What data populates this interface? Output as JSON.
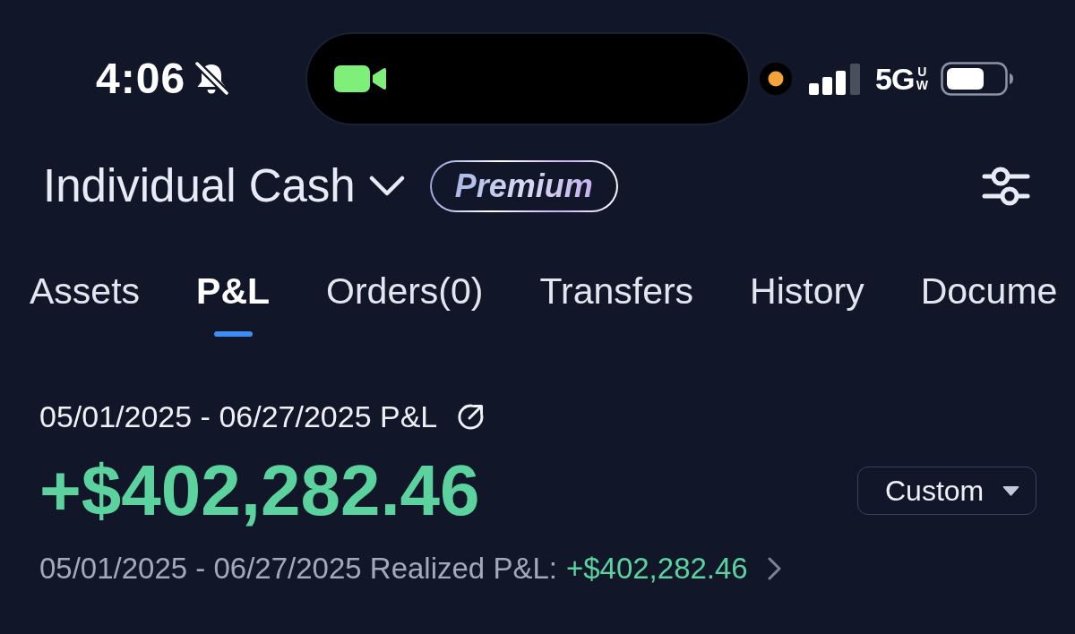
{
  "status_bar": {
    "time": "4:06",
    "silent": true,
    "network": "5G",
    "network_suffix": "UW"
  },
  "account": {
    "name": "Individual Cash",
    "badge": "Premium"
  },
  "tabs": [
    {
      "label": "Assets",
      "selected": false
    },
    {
      "label": "P&L",
      "selected": true
    },
    {
      "label": "Orders(0)",
      "selected": false
    },
    {
      "label": "Transfers",
      "selected": false
    },
    {
      "label": "History",
      "selected": false
    },
    {
      "label": "Docume",
      "selected": false
    }
  ],
  "pnl": {
    "period": "05/01/2025 - 06/27/2025 P&L",
    "value": "+$402,282.46",
    "range": "Custom",
    "realized_label": "05/01/2025 - 06/27/2025 Realized P&L:",
    "realized_value": "+$402,282.46"
  }
}
